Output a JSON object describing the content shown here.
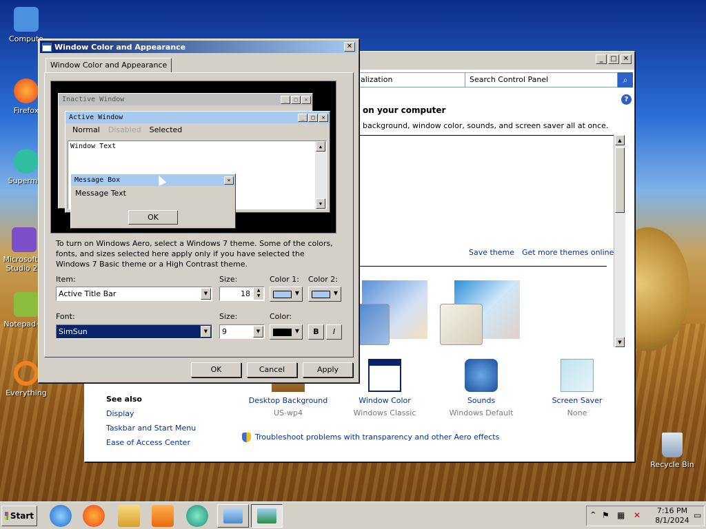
{
  "desktop": {
    "icons": [
      {
        "label": "Compute",
        "color": "#4b8fe0"
      },
      {
        "label": "Firefox",
        "color": "#f06a1c"
      },
      {
        "label": "Supermiu",
        "color": "#2fbfa0"
      },
      {
        "label": "Microsoft V Studio 20",
        "color": "#7b4fc8"
      },
      {
        "label": "Notepad++",
        "color": "#8bbd3c"
      },
      {
        "label": "Everything",
        "color": "#f08020"
      },
      {
        "label": "Recycle Bin",
        "color": "#9ab0c8"
      }
    ]
  },
  "control_panel": {
    "address_text": "alization",
    "search_placeholder": "Search Control Panel",
    "heading_suffix": "on your computer",
    "description": "background, window color, sounds, and screen saver all at once.",
    "save_theme": "Save theme",
    "get_more_themes": "Get more themes online",
    "bottom_items": [
      {
        "title": "Desktop Background",
        "subtitle": "US-wp4"
      },
      {
        "title": "Window Color",
        "subtitle": "Windows Classic"
      },
      {
        "title": "Sounds",
        "subtitle": "Windows Default"
      },
      {
        "title": "Screen Saver",
        "subtitle": "None"
      }
    ],
    "see_also": {
      "heading": "See also",
      "links": [
        "Display",
        "Taskbar and Start Menu",
        "Ease of Access Center"
      ]
    },
    "troubleshoot": "Troubleshoot problems with transparency and other Aero effects"
  },
  "dialog": {
    "title": "Window Color and Appearance",
    "tab": "Window Color and Appearance",
    "preview": {
      "inactive_title": "Inactive Window",
      "active_title": "Active Window",
      "menu_normal": "Normal",
      "menu_disabled": "Disabled",
      "menu_selected": "Selected",
      "window_text": "Window Text",
      "msgbox_title": "Message Box",
      "msgbox_text": "Message Text",
      "msgbox_ok": "OK"
    },
    "notice": "To turn on Windows Aero, select a Windows 7 theme.  Some of the colors, fonts, and sizes selected here apply only if you have selected the Windows 7 Basic theme or a High Contrast theme.",
    "item_label": "Item:",
    "item_value": "Active Title Bar",
    "size_label": "Size:",
    "size_value": "18",
    "color1_label": "Color 1:",
    "color2_label": "Color 2:",
    "color1": "#a6caf0",
    "color2": "#a6caf0",
    "font_label": "Font:",
    "font_value": "SimSun",
    "font_size_label": "Size:",
    "font_size_value": "9",
    "font_color_label": "Color:",
    "font_color": "#000000",
    "bold_label": "B",
    "italic_label": "I",
    "ok": "OK",
    "cancel": "Cancel",
    "apply": "Apply"
  },
  "taskbar": {
    "start": "Start",
    "time": "7:16 PM",
    "date": "8/1/2024"
  }
}
